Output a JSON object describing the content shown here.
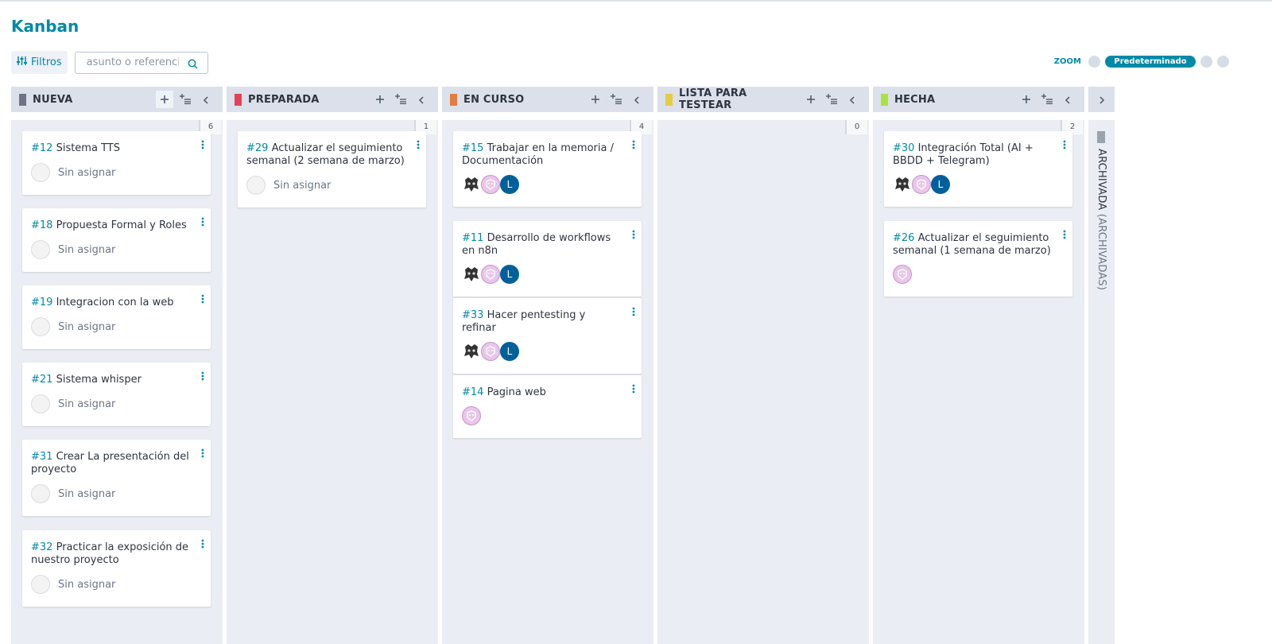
{
  "page": {
    "title": "Kanban"
  },
  "toolbar": {
    "filters_label": "Filtros",
    "search_placeholder": "asunto o referencia"
  },
  "zoom": {
    "label": "ZOOM",
    "selected": "Predeterminado"
  },
  "columns": [
    {
      "name": "NUEVA",
      "color": "#6f7385",
      "count": "6",
      "cards": [
        {
          "ref": "#12",
          "title": "Sistema TTS",
          "assignee": "Sin asignar"
        },
        {
          "ref": "#18",
          "title": "Propuesta Formal y Roles",
          "assignee": "Sin asignar"
        },
        {
          "ref": "#19",
          "title": "Integracion con la web",
          "assignee": "Sin asignar"
        },
        {
          "ref": "#21",
          "title": "Sistema whisper",
          "assignee": "Sin asignar"
        },
        {
          "ref": "#31",
          "title": "Crear La presentación del proyecto",
          "assignee": "Sin asignar"
        },
        {
          "ref": "#32",
          "title": "Practicar la exposición de nuestro proyecto",
          "assignee": "Sin asignar"
        }
      ]
    },
    {
      "name": "PREPARADA",
      "color": "#e44057",
      "count": "1",
      "cards": [
        {
          "ref": "#29",
          "title": "Actualizar el seguimiento semanal (2 semana de marzo)",
          "assignee": "Sin asignar"
        }
      ]
    },
    {
      "name": "EN CURSO",
      "color": "#e47c40",
      "count": "4",
      "cards": [
        {
          "ref": "#15",
          "title": "Trabajar en la memoria / Documentación",
          "letter": "L"
        },
        {
          "ref": "#11",
          "title": "Desarrollo de workflows en n8n",
          "letter": "L"
        },
        {
          "ref": "#33",
          "title": "Hacer pentesting y refinar",
          "letter": "L"
        },
        {
          "ref": "#14",
          "title": "Pagina web"
        }
      ]
    },
    {
      "name": "LISTA PARA TESTEAR",
      "color": "#e4ce40",
      "count": "0",
      "cards": []
    },
    {
      "name": "HECHA",
      "color": "#a8e440",
      "count": "2",
      "cards": [
        {
          "ref": "#30",
          "title": "Integración Total (AI + BBDD + Telegram)",
          "letter": "L"
        },
        {
          "ref": "#26",
          "title": "Actualizar el seguimiento semanal (1 semana de marzo)"
        }
      ]
    }
  ],
  "archived": {
    "name": "ARCHIVADA",
    "subtitle": "(ARCHIVADAS)",
    "color": "#9aa2ae"
  }
}
